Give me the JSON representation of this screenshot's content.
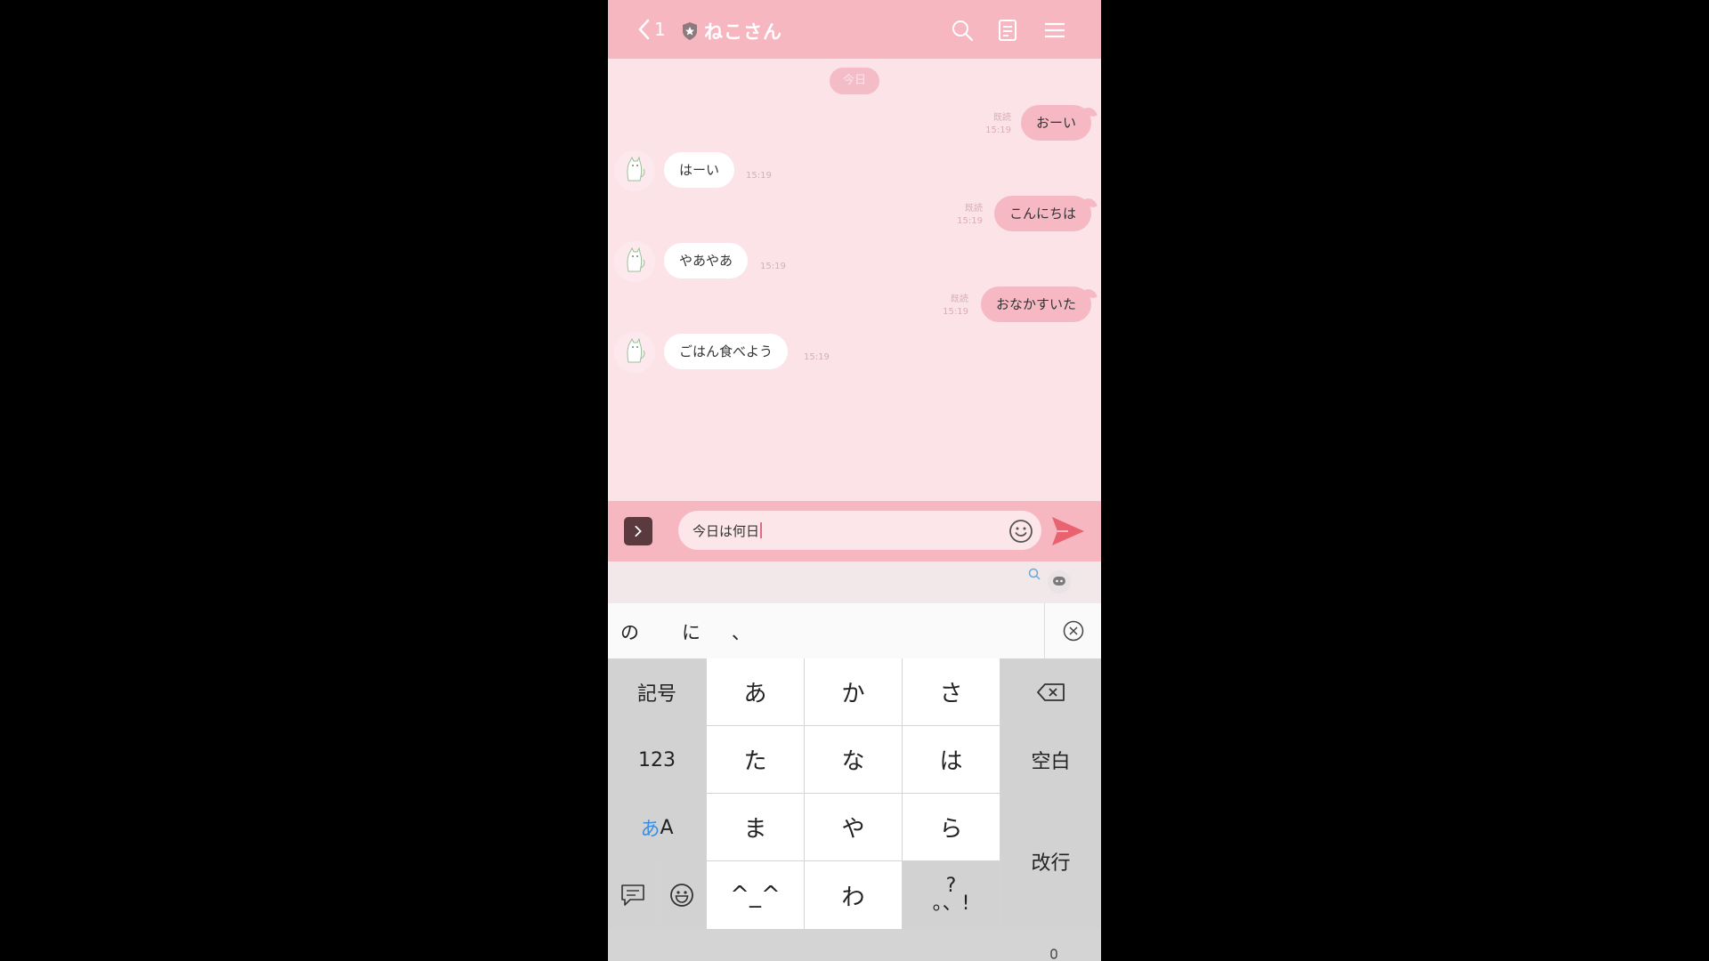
{
  "header": {
    "back_count": "1",
    "title": "ねこさん"
  },
  "chat": {
    "date_label": "今日",
    "messages": [
      {
        "dir": "out",
        "text": "おーい",
        "read": "既読",
        "time": "15:19"
      },
      {
        "dir": "in",
        "text": "はーい",
        "time": "15:19"
      },
      {
        "dir": "out",
        "text": "こんにちは",
        "read": "既読",
        "time": "15:19"
      },
      {
        "dir": "in",
        "text": "やあやあ",
        "time": "15:19"
      },
      {
        "dir": "out",
        "text": "おなかすいた",
        "read": "既読",
        "time": "15:19"
      },
      {
        "dir": "in",
        "text": "ごはん食べよう",
        "time": "15:19"
      }
    ]
  },
  "input": {
    "value": "今日は何日"
  },
  "candidates": [
    "の",
    "に",
    "、"
  ],
  "keyboard": {
    "symbols": "記号",
    "numbers": "123",
    "mode_a": "あ",
    "mode_b": "A",
    "space": "空白",
    "enter": "改行",
    "kana": [
      "あ",
      "か",
      "さ",
      "た",
      "な",
      "は",
      "ま",
      "や",
      "ら",
      "^_^",
      "わ"
    ],
    "punct_top": "?",
    "punct_bottom": "。、!"
  },
  "colors": {
    "header": "#f6b7c1",
    "chat_bg": "#fbe3e8",
    "out_bubble": "#f6b9c4",
    "send": "#e8626f"
  }
}
